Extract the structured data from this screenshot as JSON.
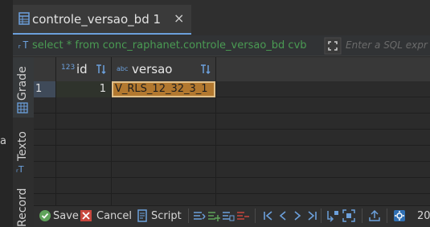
{
  "tab": {
    "title": "controle_versao_bd 1",
    "icon": "table-icon",
    "close": "×"
  },
  "query": {
    "icon_glyph": "ᵣT",
    "text": "select * from conc_raphanet.controle_versao_bd cvb",
    "filter_placeholder": "Enter a SQL expr"
  },
  "side_tabs": {
    "grade": "Grade",
    "texto": "Texto",
    "record": "Record",
    "cut_text": "a"
  },
  "grid": {
    "columns": [
      {
        "name": "id",
        "type_icon": "123"
      },
      {
        "name": "versao",
        "type_icon": "abc"
      }
    ],
    "rows": [
      {
        "num": "1",
        "id": "1",
        "versao": "V_RLS_12_32_3_1"
      }
    ]
  },
  "toolbar": {
    "save": "Save",
    "cancel": "Cancel",
    "script": "Script",
    "page_size": "20"
  },
  "colors": {
    "accent": "#6ca0dc",
    "selected_cell": "#b2782f",
    "query_text": "#4a9b53",
    "save_green": "#5fa35a",
    "cancel_red": "#c9463d"
  }
}
